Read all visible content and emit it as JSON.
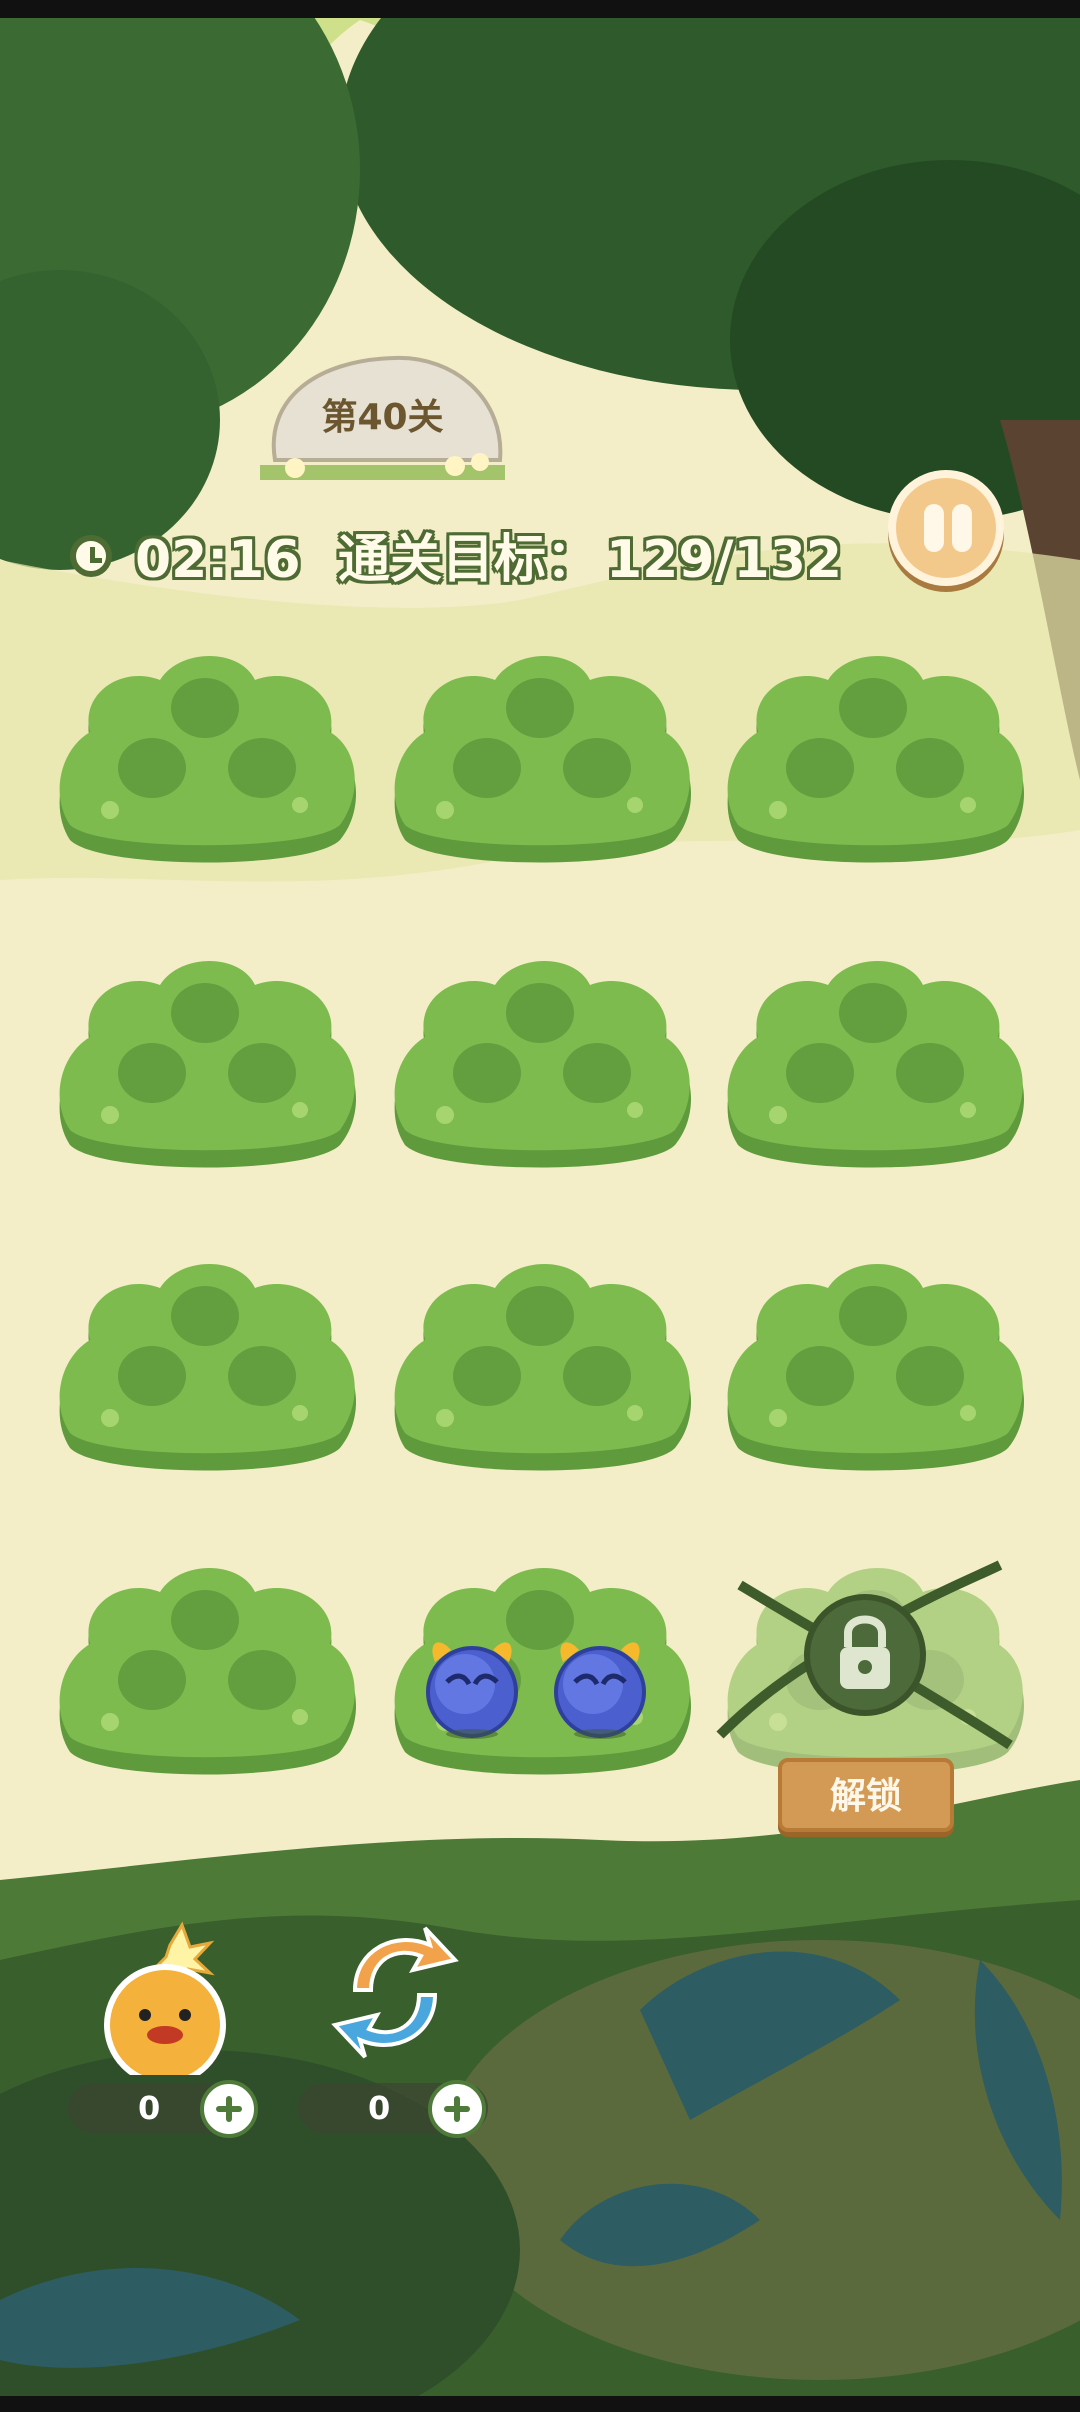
{
  "level": {
    "title": "第40关"
  },
  "hud": {
    "timer": "02:16",
    "goal_label": "通关目标：",
    "goal_progress": "129/132"
  },
  "board": {
    "rows": 4,
    "cols": 3,
    "occupied_cell": {
      "row": 4,
      "col": 2,
      "pieces": 2,
      "piece_type": "blue-horned-creature"
    },
    "locked_cell": {
      "row": 4,
      "col": 3,
      "button_label": "解锁"
    }
  },
  "powerups": [
    {
      "name": "bomb-chick",
      "count": "0"
    },
    {
      "name": "shuffle",
      "count": "0"
    }
  ],
  "colors": {
    "bush": "#7dbb4f",
    "bush_shadow": "#5f9a3c",
    "hud_text": "#fffbe8",
    "hud_outline": "#4f6b34",
    "pause_button": "#f3c98b",
    "unlock_button": "#d39a55"
  }
}
